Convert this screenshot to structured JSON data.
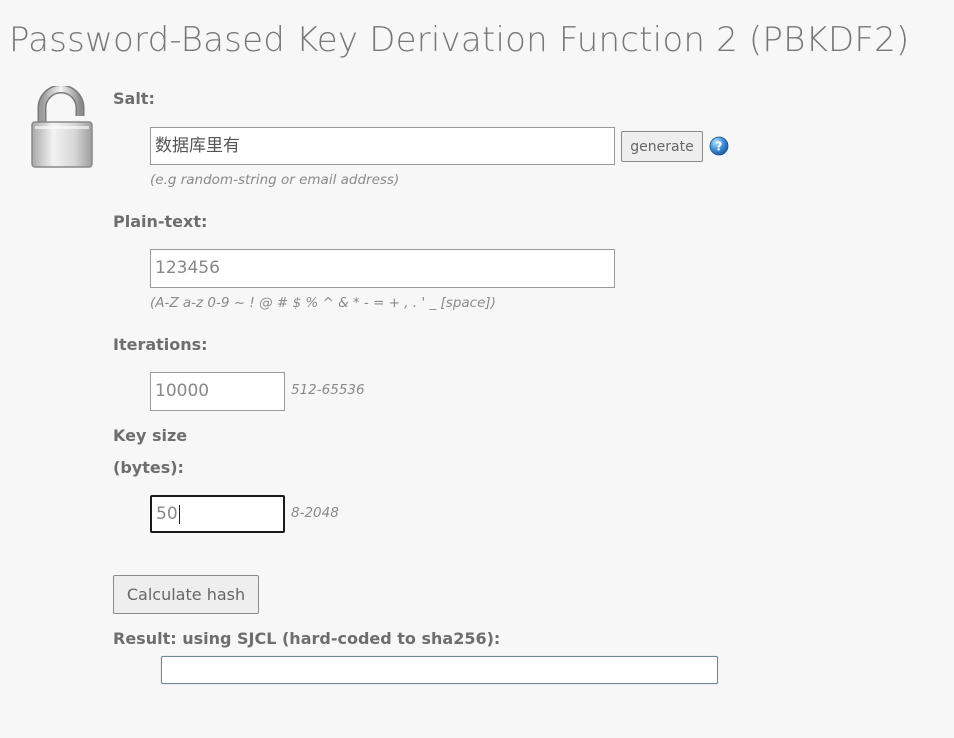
{
  "page": {
    "title": "Password-Based Key Derivation Function 2 (PBKDF2)"
  },
  "salt": {
    "label": "Salt:",
    "value": "数据库里有",
    "hint": "(e.g random-string or email address)",
    "generate_label": "generate"
  },
  "plaintext": {
    "label": "Plain-text:",
    "value": "123456",
    "hint": "(A-Z a-z 0-9 ~ ! @ # $ % ^ & * - = + , . ' _ [space])"
  },
  "iterations": {
    "label": "Iterations:",
    "value": "10000",
    "range": "512-65536"
  },
  "keysize": {
    "label_line1": "Key size",
    "label_line2": "(bytes):",
    "value": "50",
    "range": "8-2048"
  },
  "calculate_label": "Calculate hash",
  "result": {
    "label": "Result: using SJCL (hard-coded to sha256):",
    "value": ""
  },
  "icons": {
    "lock": "padlock-open-icon",
    "help": "question-mark-icon"
  }
}
